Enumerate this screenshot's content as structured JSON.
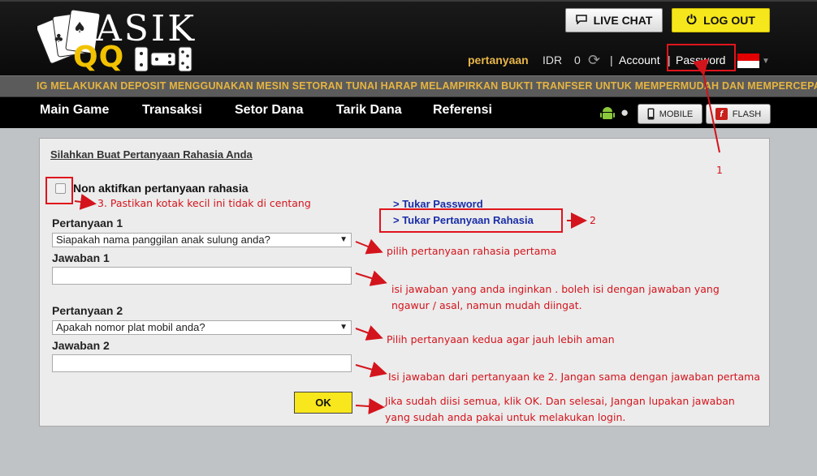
{
  "header": {
    "logo": {
      "word": "ASIK",
      "word2": "QQ"
    },
    "live_chat": "LIVE CHAT",
    "logout": "LOG OUT",
    "user": {
      "name": "pertanyaan",
      "currency": "IDR",
      "balance": "0",
      "sep": "|",
      "account": "Account",
      "password": "Password"
    }
  },
  "marquee": "IG MELAKUKAN DEPOSIT MENGGUNAKAN MESIN SETORAN TUNAI HARAP MELAMPIRKAN BUKTI TRANFSER UNTUK MEMPERMUDAH DAN MEMPERCEPAT",
  "nav": {
    "items": [
      "Main Game",
      "Transaksi",
      "Setor Dana",
      "Tarik Dana",
      "Referensi"
    ],
    "mobile": "MOBILE",
    "flash": "FLASH",
    "flash_glyph": "f"
  },
  "form": {
    "title": "Silahkan Buat Pertanyaan Rahasia Anda",
    "disable_label": "Non aktifkan pertanyaan rahasia",
    "q1_label": "Pertanyaan 1",
    "q1_value": "Siapakah nama panggilan anak sulung anda?",
    "a1_label": "Jawaban 1",
    "a1_value": "",
    "q2_label": "Pertanyaan 2",
    "q2_value": "Apakah nomor plat mobil anda?",
    "a2_label": "Jawaban 2",
    "a2_value": "",
    "ok": "OK",
    "links": [
      "> Tukar Password",
      "> Tukar Pertanyaan Rahasia"
    ]
  },
  "annotations": {
    "n1": "1",
    "n2": "2",
    "n3": "3. Pastikan kotak kecil ini tidak di centang",
    "q1": "pilih pertanyaan rahasia pertama",
    "a1_line1": "isi jawaban yang anda inginkan . boleh isi dengan jawaban yang",
    "a1_line2": "ngawur / asal, namun mudah diingat.",
    "q2": "Pilih pertanyaan kedua agar jauh lebih aman",
    "a2": "Isi jawaban dari pertanyaan ke 2. Jangan sama dengan jawaban pertama",
    "ok_line1": "Jika sudah diisi semua, klik OK. Dan selesai, Jangan lupakan jawaban",
    "ok_line2": "yang sudah anda pakai untuk melakukan login."
  },
  "colors": {
    "accent_yellow": "#f6e71c",
    "annotation_red": "#d4141c",
    "link_blue": "#1a2ea8",
    "username_gold": "#e8b64a"
  }
}
